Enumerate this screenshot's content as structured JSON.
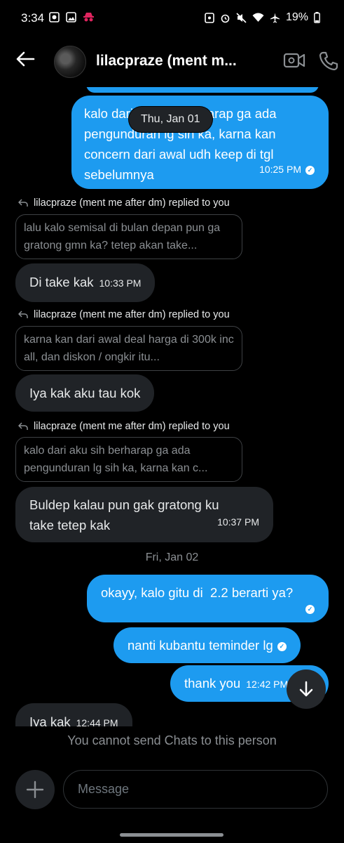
{
  "status_bar": {
    "time": "3:34",
    "battery": "19%"
  },
  "header": {
    "title": "lilacpraze (ment m..."
  },
  "floating_date": "Thu, Jan 01",
  "messages": [
    {
      "text": "kalo dari aku sih berharap ga ada pengunduran lg sih ka, karna kan concern dari awal udh keep di tgl sebelumnya",
      "time": "10:25 PM"
    },
    {
      "reply_label": "lilacpraze (ment me after dm) replied to you",
      "quote": "lalu kalo semisal di bulan depan pun ga gratong gmn ka? tetep akan take...",
      "text": "Di take kak",
      "time": "10:33 PM"
    },
    {
      "reply_label": "lilacpraze (ment me after dm) replied to you",
      "quote": "karna kan dari awal deal harga di 300k inc all, dan diskon / ongkir itu...",
      "text": "Iya kak aku tau kok"
    },
    {
      "reply_label": "lilacpraze (ment me after dm) replied to you",
      "quote": "kalo dari aku sih berharap ga ada pengunduran lg sih ka, karna kan c...",
      "text": "Buldep kalau pun gak gratong ku take tetep kak",
      "time": "10:37 PM"
    },
    {
      "date_separator": "Fri, Jan 02"
    },
    {
      "text": "okayy, kalo gitu di  2.2 berarti ya?"
    },
    {
      "text": "nanti kubantu teminder lg"
    },
    {
      "text": "thank you",
      "time": "12:42 PM"
    },
    {
      "text": "Iya kak",
      "time": "12:44 PM"
    }
  ],
  "footer": {
    "notice": "You cannot send Chats to this person",
    "input_placeholder": "Message"
  }
}
